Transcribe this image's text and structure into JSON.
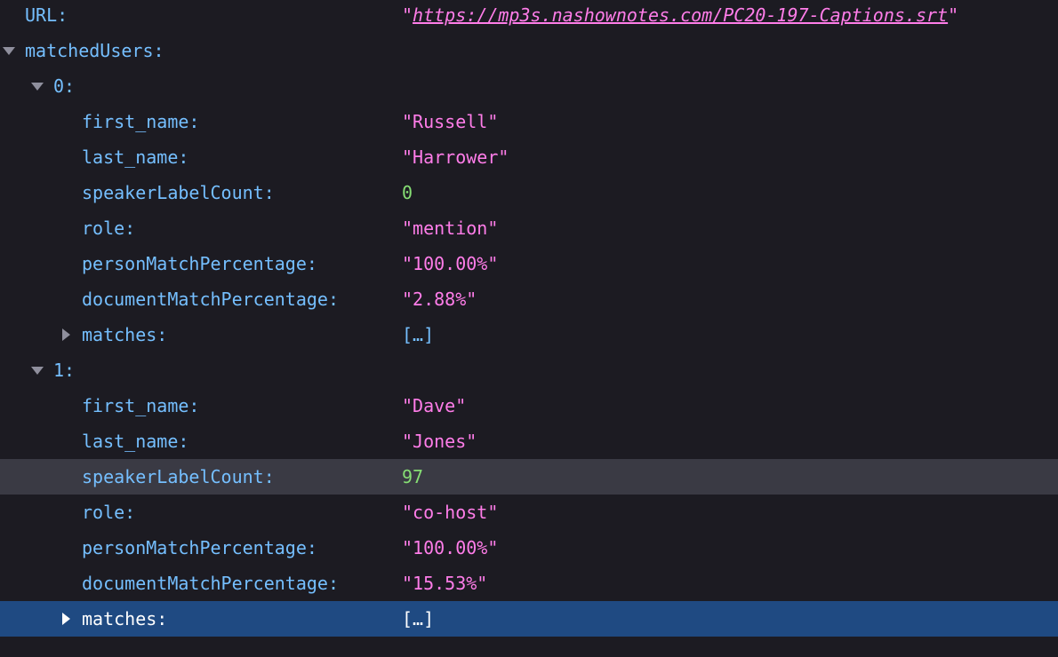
{
  "url_row": {
    "key": "URL:",
    "quote_open": "\"",
    "link": "https://mp3s.nashownotes.com/PC20-197-Captions.srt",
    "quote_close": "\""
  },
  "matched_users_key": "matchedUsers:",
  "users": [
    {
      "index_key": "0:",
      "first_name_key": "first_name:",
      "first_name": "\"Russell\"",
      "last_name_key": "last_name:",
      "last_name": "\"Harrower\"",
      "speaker_key": "speakerLabelCount:",
      "speaker": "0",
      "role_key": "role:",
      "role": "\"mention\"",
      "person_key": "personMatchPercentage:",
      "person": "\"100.00%\"",
      "document_key": "documentMatchPercentage:",
      "document": "\"2.88%\"",
      "matches_key": "matches:",
      "matches": "[…]"
    },
    {
      "index_key": "1:",
      "first_name_key": "first_name:",
      "first_name": "\"Dave\"",
      "last_name_key": "last_name:",
      "last_name": "\"Jones\"",
      "speaker_key": "speakerLabelCount:",
      "speaker": "97",
      "role_key": "role:",
      "role": "\"co-host\"",
      "person_key": "personMatchPercentage:",
      "person": "\"100.00%\"",
      "document_key": "documentMatchPercentage:",
      "document": "\"15.53%\"",
      "matches_key": "matches:",
      "matches": "[…]"
    }
  ],
  "colors": {
    "background": "#1c1b22",
    "key": "#75bfff",
    "string": "#ff7de9",
    "number": "#86de74",
    "hover_row": "#3a3a44",
    "selected_row": "#1f4a82"
  },
  "icons": {
    "expanded": "chevron-down-icon",
    "collapsed": "chevron-right-icon"
  }
}
